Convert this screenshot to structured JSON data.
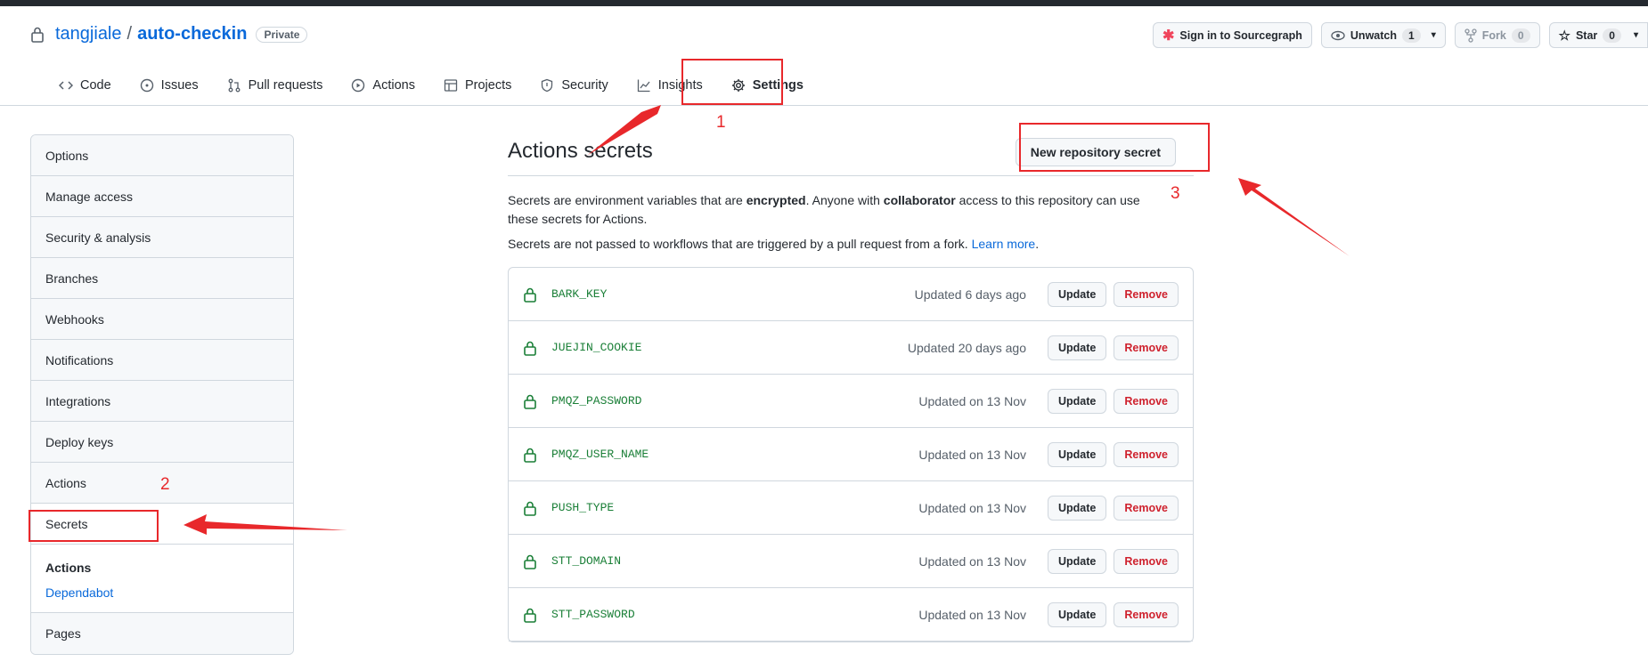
{
  "repo": {
    "owner": "tangjiale",
    "separator": "/",
    "name": "auto-checkin",
    "visibility": "Private"
  },
  "header_actions": {
    "sourcegraph": "Sign in to Sourcegraph",
    "watch": {
      "label": "Unwatch",
      "count": "1"
    },
    "fork": {
      "label": "Fork",
      "count": "0"
    },
    "star": {
      "label": "Star",
      "count": "0"
    }
  },
  "tabs": [
    {
      "label": "Code",
      "icon": "code-icon"
    },
    {
      "label": "Issues",
      "icon": "issue-icon"
    },
    {
      "label": "Pull requests",
      "icon": "pull-request-icon"
    },
    {
      "label": "Actions",
      "icon": "play-icon"
    },
    {
      "label": "Projects",
      "icon": "table-icon"
    },
    {
      "label": "Security",
      "icon": "shield-icon"
    },
    {
      "label": "Insights",
      "icon": "graph-icon"
    },
    {
      "label": "Settings",
      "icon": "gear-icon",
      "selected": true
    }
  ],
  "sidebar": {
    "items": [
      {
        "label": "Options"
      },
      {
        "label": "Manage access"
      },
      {
        "label": "Security & analysis"
      },
      {
        "label": "Branches"
      },
      {
        "label": "Webhooks"
      },
      {
        "label": "Notifications"
      },
      {
        "label": "Integrations"
      },
      {
        "label": "Deploy keys"
      },
      {
        "label": "Actions"
      },
      {
        "label": "Secrets",
        "active": true
      }
    ],
    "group": {
      "heading": "Actions",
      "link": "Dependabot"
    },
    "last": "Pages"
  },
  "main": {
    "title": "Actions secrets",
    "new_button": "New repository secret",
    "desc": {
      "p1": "Secrets are environment variables that are ",
      "b1": "encrypted",
      "p2": ". Anyone with ",
      "b2": "collaborator",
      "p3": " access to this repository can use these secrets for Actions."
    },
    "desc2": "Secrets are not passed to workflows that are triggered by a pull request from a fork. ",
    "learn_more": "Learn more",
    "period": ".",
    "update_label": "Update",
    "remove_label": "Remove",
    "secrets": [
      {
        "name": "BARK_KEY",
        "updated": "Updated 6 days ago"
      },
      {
        "name": "JUEJIN_COOKIE",
        "updated": "Updated 20 days ago"
      },
      {
        "name": "PMQZ_PASSWORD",
        "updated": "Updated on 13 Nov"
      },
      {
        "name": "PMQZ_USER_NAME",
        "updated": "Updated on 13 Nov"
      },
      {
        "name": "PUSH_TYPE",
        "updated": "Updated on 13 Nov"
      },
      {
        "name": "STT_DOMAIN",
        "updated": "Updated on 13 Nov"
      },
      {
        "name": "STT_PASSWORD",
        "updated": "Updated on 13 Nov"
      }
    ]
  },
  "annotations": {
    "n1": "1",
    "n2": "2",
    "n3": "3",
    "color": "#e8282b"
  }
}
